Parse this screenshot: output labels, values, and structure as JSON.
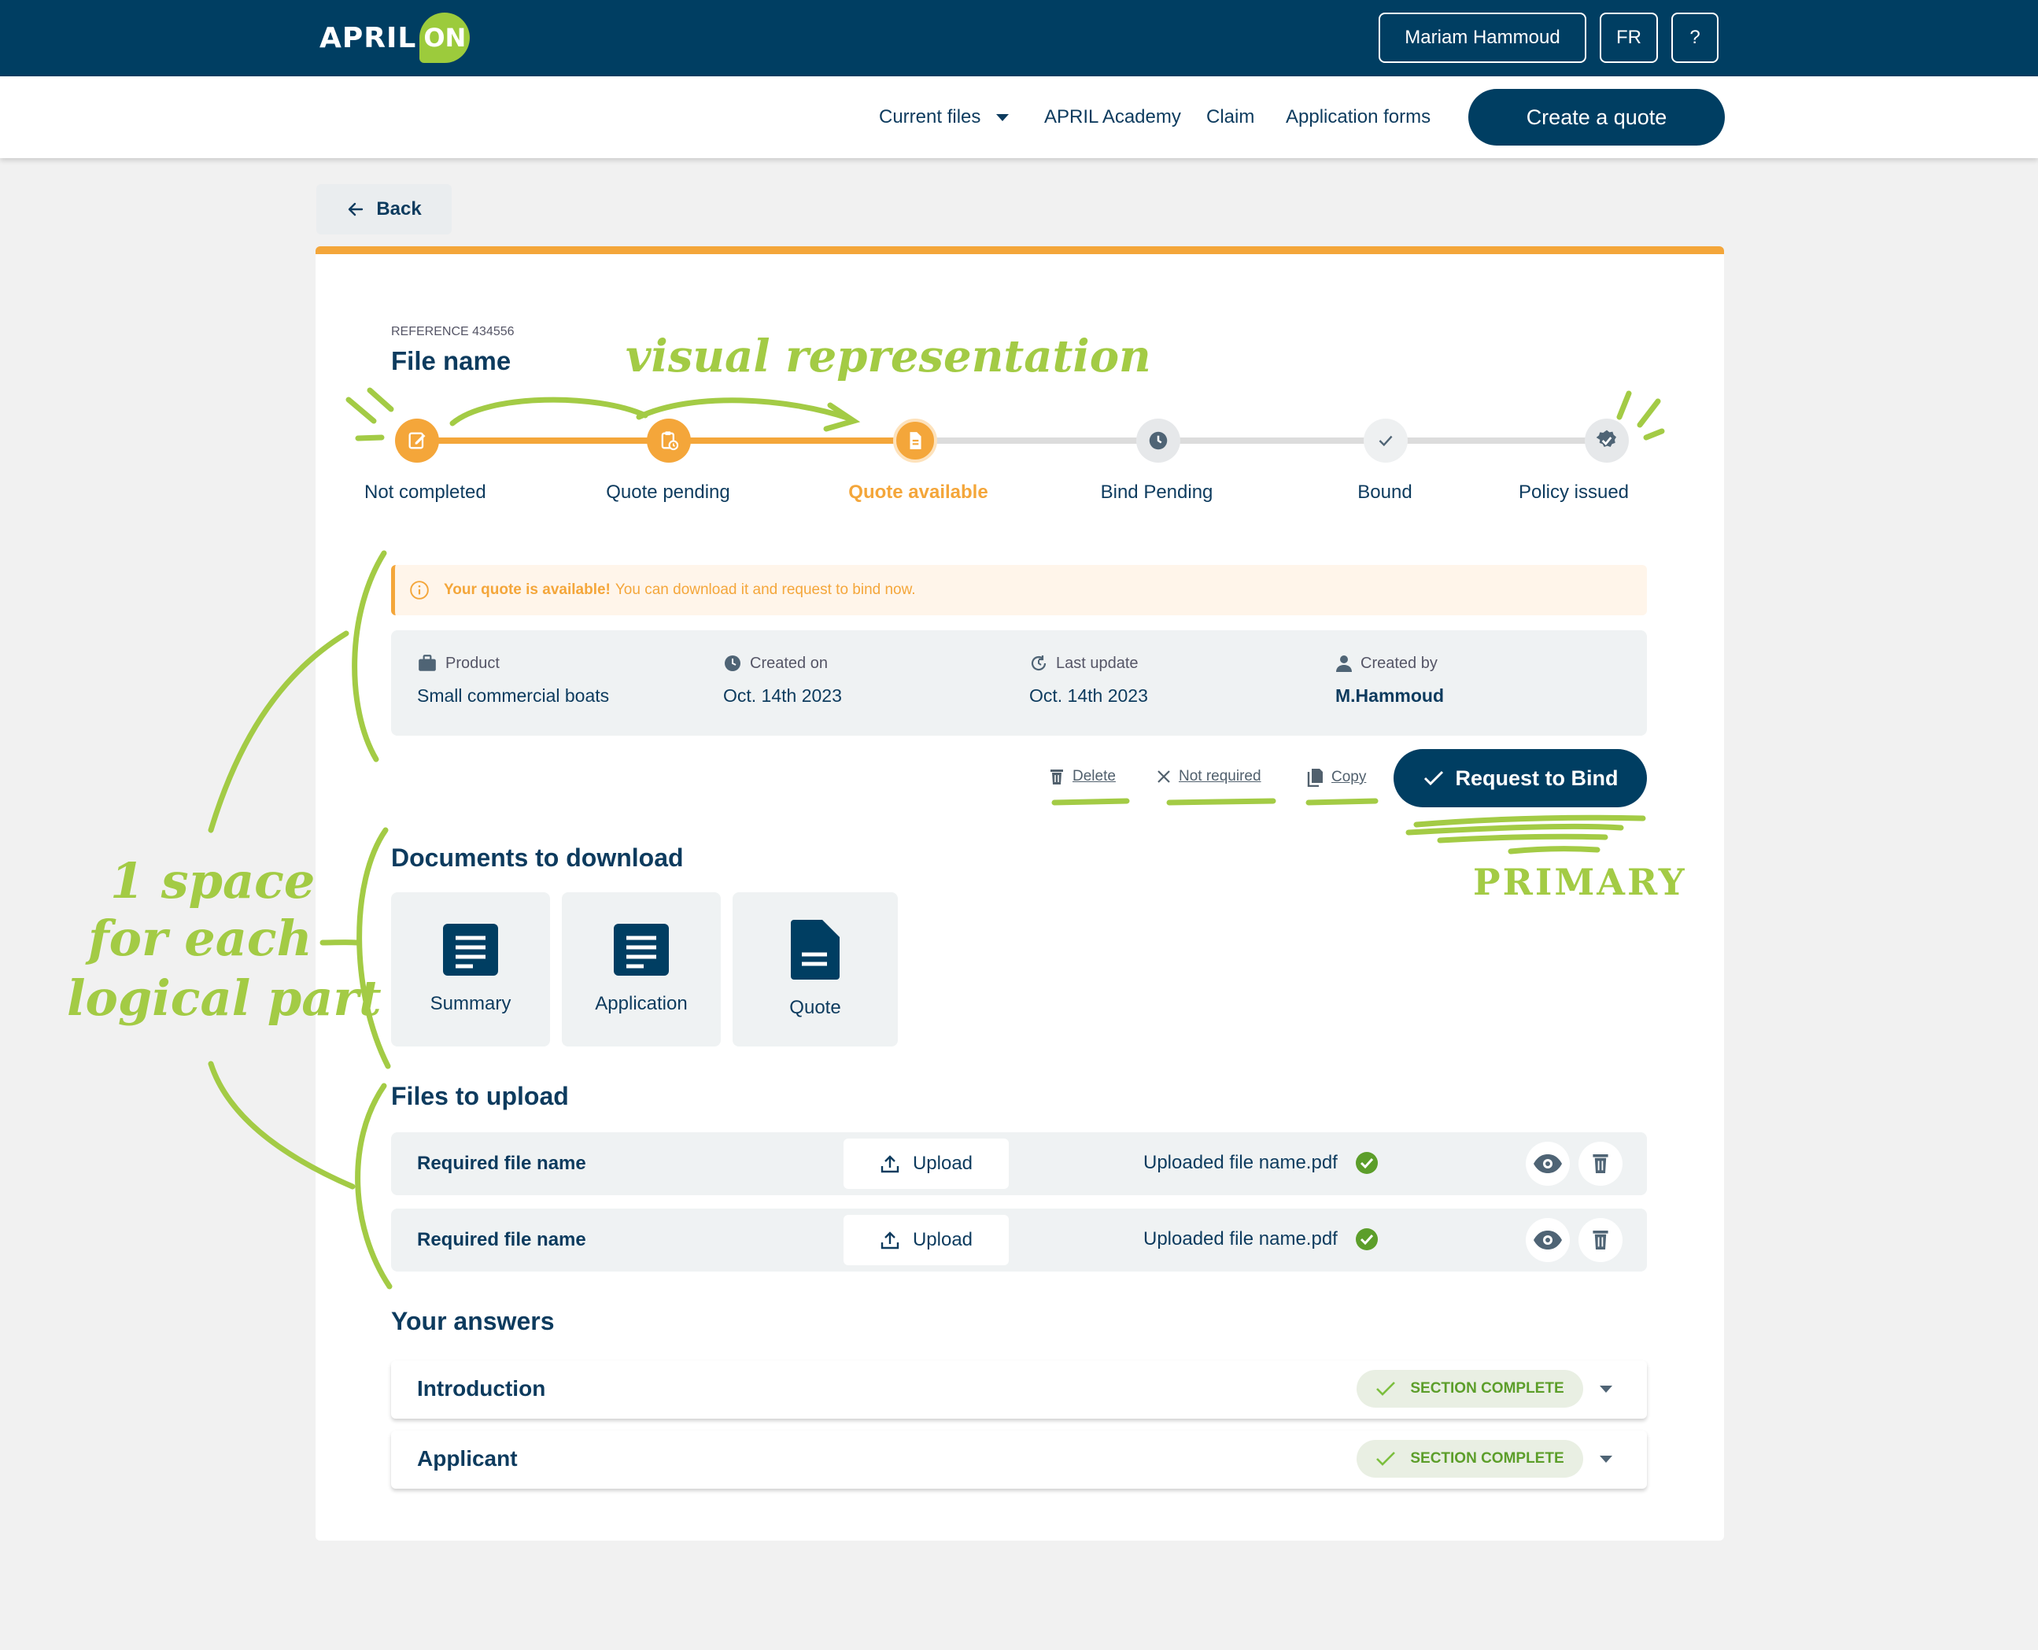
{
  "header": {
    "logo_main": "APRIL",
    "logo_on": "ON",
    "user_name": "Mariam Hammoud",
    "language": "FR",
    "help": "?"
  },
  "nav": {
    "current_files": "Current files",
    "academy": "APRIL Academy",
    "claim": "Claim",
    "application_forms": "Application forms",
    "create_quote": "Create a quote"
  },
  "back_label": "Back",
  "file": {
    "reference": "REFERENCE 434556",
    "name": "File name"
  },
  "steps": [
    {
      "label": "Not completed",
      "state": "done"
    },
    {
      "label": "Quote pending",
      "state": "done"
    },
    {
      "label": "Quote available",
      "state": "current"
    },
    {
      "label": "Bind Pending",
      "state": "todo"
    },
    {
      "label": "Bound",
      "state": "todo"
    },
    {
      "label": "Policy issued",
      "state": "todo"
    }
  ],
  "alert": {
    "strong": "Your quote is available!",
    "text": "You can download it and request to bind now."
  },
  "meta": {
    "product_label": "Product",
    "product_value": "Small commercial boats",
    "created_label": "Created on",
    "created_value": "Oct. 14th 2023",
    "updated_label": "Last update",
    "updated_value": "Oct. 14th 2023",
    "by_label": "Created by",
    "by_value": "M.Hammoud"
  },
  "actions": {
    "delete": "Delete",
    "not_required": "Not required",
    "copy": "Copy",
    "request_bind": "Request to Bind"
  },
  "documents": {
    "title": "Documents to download",
    "items": [
      "Summary",
      "Application",
      "Quote"
    ]
  },
  "uploads": {
    "title": "Files to upload",
    "rows": [
      {
        "required": "Required file name",
        "button": "Upload",
        "uploaded": "Uploaded file name.pdf"
      },
      {
        "required": "Required file name",
        "button": "Upload",
        "uploaded": "Uploaded file name.pdf"
      }
    ]
  },
  "answers": {
    "title": "Your answers",
    "rows": [
      {
        "title": "Introduction",
        "badge": "SECTION COMPLETE"
      },
      {
        "title": "Applicant",
        "badge": "SECTION COMPLETE"
      }
    ]
  },
  "annotations": {
    "visual": "visual representation",
    "space_line1": "1 space",
    "space_line2": "for each",
    "space_line3": "logical part",
    "primary": "PRIMARY"
  },
  "colors": {
    "navy": "#003e62",
    "orange": "#f4a63a",
    "green_annotation": "#a3cb45",
    "success": "#5c9e2a"
  }
}
